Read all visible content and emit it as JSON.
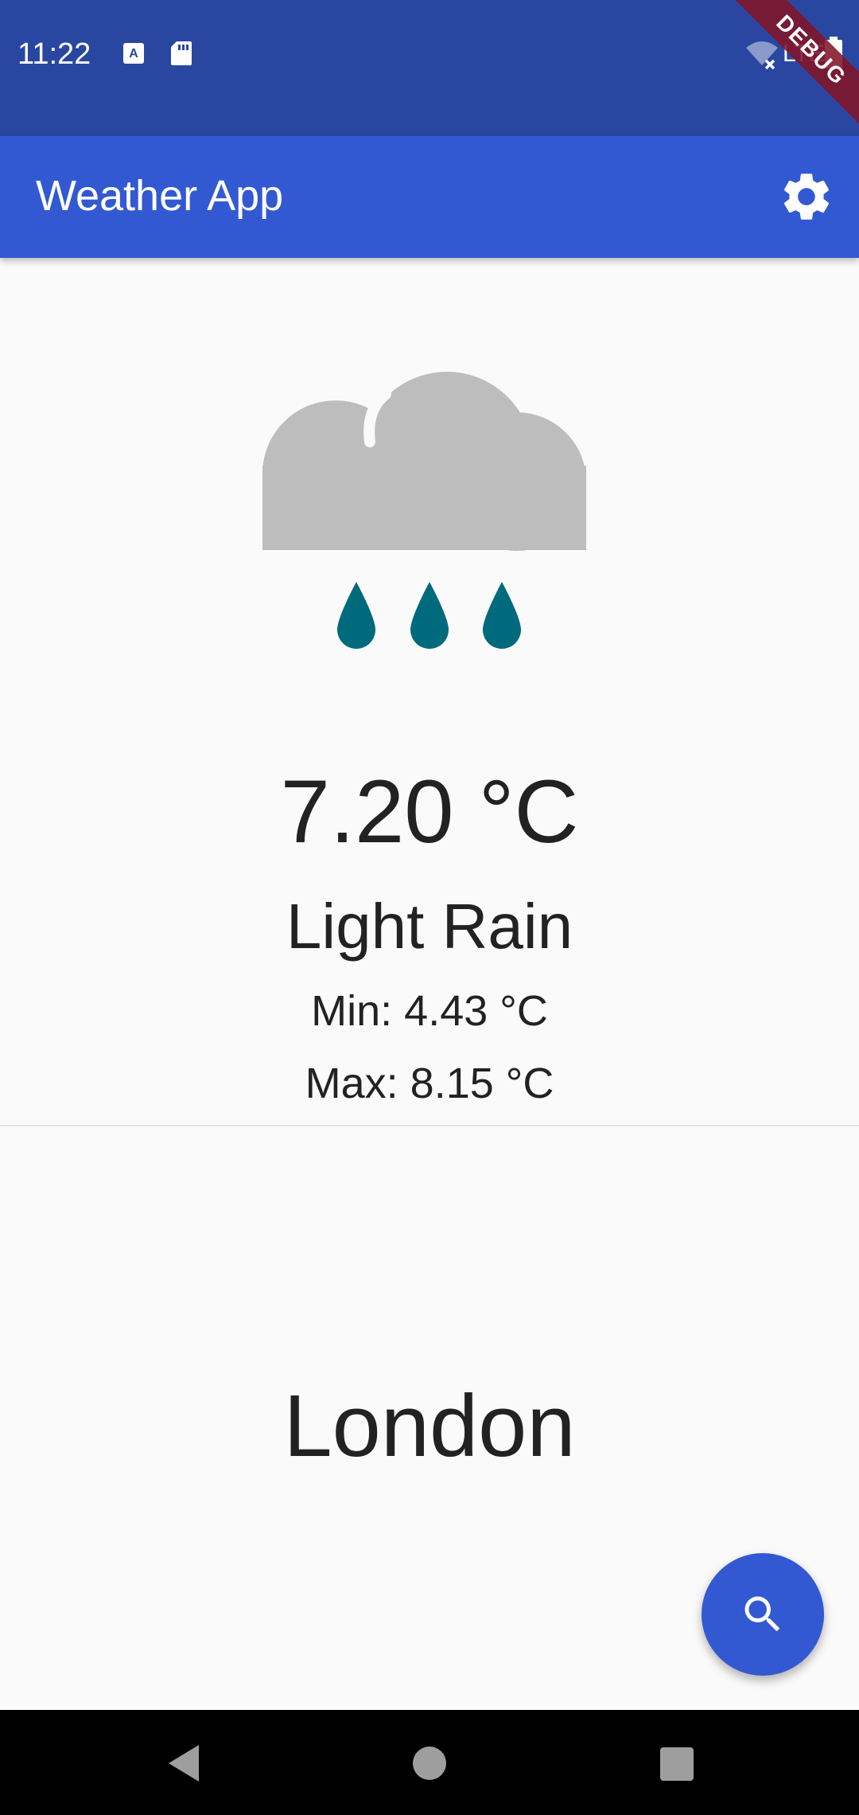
{
  "status_bar": {
    "time": "11:22",
    "icons": [
      "a-notification-icon",
      "sd-card-icon",
      "wifi-off-icon",
      "lte-icon",
      "battery-icon"
    ],
    "network_text": "LTE",
    "debug_label": "DEBUG",
    "bg_color": "#2947a1"
  },
  "app_bar": {
    "title": "Weather App",
    "settings_icon": "gear-icon",
    "bg_color": "#3359d2"
  },
  "weather": {
    "icon": "cloud-rain-icon",
    "temperature": "7.20 °C",
    "condition": "Light Rain",
    "min": "Min: 4.43 °C",
    "max": "Max: 8.15 °C",
    "cloud_color": "#bdbdbd",
    "drop_color": "#006a7d"
  },
  "location": {
    "city": "London"
  },
  "fab": {
    "icon": "search-icon",
    "color": "#3359d2"
  },
  "nav_bar": {
    "buttons": [
      "back-icon",
      "home-icon",
      "recents-icon"
    ]
  }
}
